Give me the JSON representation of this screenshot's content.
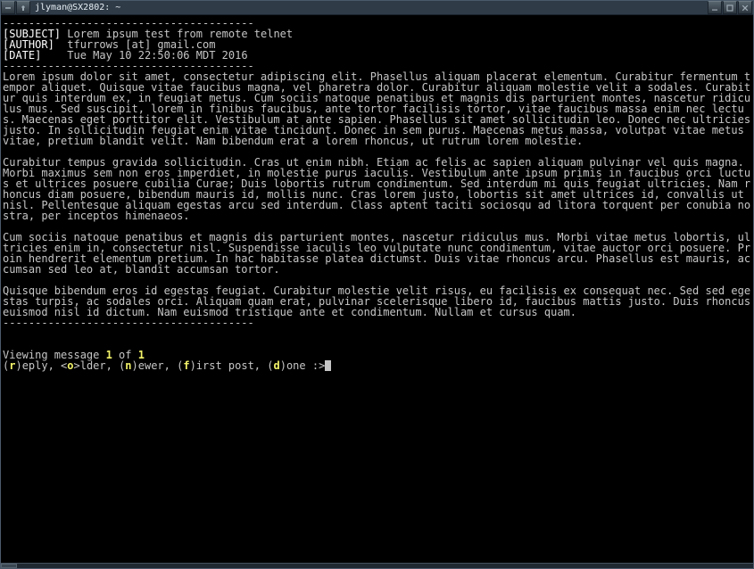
{
  "window": {
    "title": "jlyman@SX2802: ~",
    "icons": {
      "menu": "menu-icon",
      "sticky": "pin-icon",
      "min": "minimize-icon",
      "max": "maximize-icon",
      "close": "close-icon"
    }
  },
  "divider": "---------------------------------------",
  "headers": {
    "subject_label": "[SUBJECT]",
    "subject": "Lorem ipsum test from remote telnet",
    "author_label": "[AUTHOR]",
    "author": "tfurrows [at] gmail.com",
    "date_label": "[DATE]",
    "date": "Tue May 10 22:50:06 MDT 2016"
  },
  "paragraphs": [
    "Lorem ipsum dolor sit amet, consectetur adipiscing elit. Phasellus aliquam placerat elementum. Curabitur fermentum tempor aliquet. Quisque vitae faucibus magna, vel pharetra dolor. Curabitur aliquam molestie velit a sodales. Curabitur quis interdum ex, in feugiat metus. Cum sociis natoque penatibus et magnis dis parturient montes, nascetur ridiculus mus. Sed suscipit, lorem in finibus faucibus, ante tortor facilisis tortor, vitae faucibus massa enim nec lectus. Maecenas eget porttitor elit. Vestibulum at ante sapien. Phasellus sit amet sollicitudin leo. Donec nec ultricies justo. In sollicitudin feugiat enim vitae tincidunt. Donec in sem purus. Maecenas metus massa, volutpat vitae metus vitae, pretium blandit velit. Nam bibendum erat a lorem rhoncus, ut rutrum lorem molestie.",
    "Curabitur tempus gravida sollicitudin. Cras ut enim nibh. Etiam ac felis ac sapien aliquam pulvinar vel quis magna. Morbi maximus sem non eros imperdiet, in molestie purus iaculis. Vestibulum ante ipsum primis in faucibus orci luctus et ultrices posuere cubilia Curae; Duis lobortis rutrum condimentum. Sed interdum mi quis feugiat ultricies. Nam rhoncus diam posuere, bibendum mauris id, mollis nunc. Cras lorem justo, lobortis sit amet ultrices id, convallis ut nisl. Pellentesque aliquam egestas arcu sed interdum. Class aptent taciti sociosqu ad litora torquent per conubia nostra, per inceptos himenaeos.",
    "Cum sociis natoque penatibus et magnis dis parturient montes, nascetur ridiculus mus. Morbi vitae metus lobortis, ultricies enim in, consectetur nisl. Suspendisse iaculis leo vulputate nunc condimentum, vitae auctor orci posuere. Proin hendrerit elementum pretium. In hac habitasse platea dictumst. Duis vitae rhoncus arcu. Phasellus est mauris, accumsan sed leo at, blandit accumsan tortor.",
    "Quisque bibendum eros id egestas feugiat. Curabitur molestie velit risus, eu facilisis ex consequat nec. Sed sed egestas turpis, ac sodales orci. Aliquam quam erat, pulvinar scelerisque libero id, faucibus mattis justo. Duis rhoncus euismod nisl id dictum. Nam euismod tristique ante et condimentum. Nullam et cursus quam."
  ],
  "status": {
    "prefix": "Viewing message ",
    "current": "1",
    "mid": " of ",
    "total": "1"
  },
  "prompt": {
    "p1a": "(",
    "k1": "r",
    "p1b": ")eply, <",
    "k2": "o",
    "p2b": ">lder, (",
    "k3": "n",
    "p3b": ")ewer, (",
    "k4": "f",
    "p4b": ")irst post, (",
    "k5": "d",
    "p5b": ")one :>"
  }
}
